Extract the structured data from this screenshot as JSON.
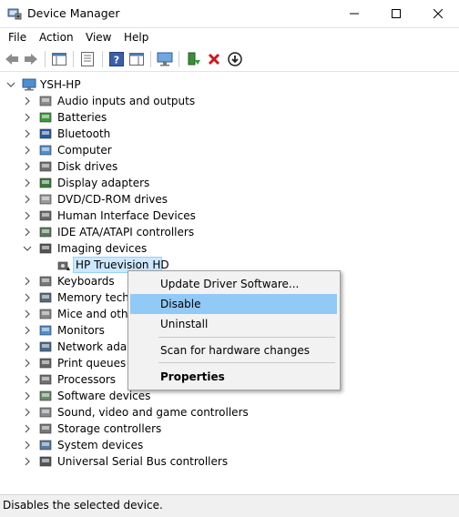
{
  "window": {
    "title": "Device Manager",
    "controls": [
      "minimize",
      "maximize",
      "close"
    ]
  },
  "menu": {
    "items": [
      "File",
      "Action",
      "View",
      "Help"
    ]
  },
  "toolbar": {
    "icons": [
      "back-arrow-icon",
      "forward-arrow-icon",
      "show-hide-tree-icon",
      "properties-icon",
      "help-icon",
      "action-pane-icon",
      "scan-hardware-icon",
      "update-driver-icon",
      "uninstall-icon",
      "disable-device-icon"
    ]
  },
  "tree": {
    "root": "YSH-HP",
    "categories": [
      {
        "label": "Audio inputs and outputs",
        "icon": "speaker-icon"
      },
      {
        "label": "Batteries",
        "icon": "battery-icon"
      },
      {
        "label": "Bluetooth",
        "icon": "bluetooth-icon"
      },
      {
        "label": "Computer",
        "icon": "computer-icon"
      },
      {
        "label": "Disk drives",
        "icon": "disk-drive-icon"
      },
      {
        "label": "Display adapters",
        "icon": "display-adapter-icon"
      },
      {
        "label": "DVD/CD-ROM drives",
        "icon": "dvd-icon"
      },
      {
        "label": "Human Interface Devices",
        "icon": "hid-icon"
      },
      {
        "label": "IDE ATA/ATAPI controllers",
        "icon": "ide-controller-icon"
      },
      {
        "label": "Imaging devices",
        "icon": "camera-icon"
      },
      {
        "label": "Keyboards",
        "icon": "keyboard-icon"
      },
      {
        "label": "Memory techn",
        "icon": "memory-icon"
      },
      {
        "label": "Mice and othe",
        "icon": "mouse-icon"
      },
      {
        "label": "Monitors",
        "icon": "monitor-icon"
      },
      {
        "label": "Network adapt",
        "icon": "network-adapter-icon"
      },
      {
        "label": "Print queues",
        "icon": "printer-icon"
      },
      {
        "label": "Processors",
        "icon": "processor-icon"
      },
      {
        "label": "Software devices",
        "icon": "software-device-icon"
      },
      {
        "label": "Sound, video and game controllers",
        "icon": "sound-icon"
      },
      {
        "label": "Storage controllers",
        "icon": "storage-controller-icon"
      },
      {
        "label": "System devices",
        "icon": "system-device-icon"
      },
      {
        "label": "Universal Serial Bus controllers",
        "icon": "usb-icon"
      }
    ],
    "expanded_child": {
      "label": "HP Truevision HD",
      "icon": "webcam-icon"
    }
  },
  "context_menu": {
    "items": [
      {
        "label": "Update Driver Software...",
        "bold": false
      },
      {
        "label": "Disable",
        "bold": false,
        "highlighted": true
      },
      {
        "label": "Uninstall",
        "bold": false
      },
      {
        "label": "Scan for hardware changes",
        "bold": false
      },
      {
        "label": "Properties",
        "bold": true
      }
    ]
  },
  "status": {
    "text": "Disables the selected device."
  },
  "colors": {
    "selection": "#cce8ff",
    "menu_highlight": "#91c9f7",
    "close_red": "#e81123"
  }
}
